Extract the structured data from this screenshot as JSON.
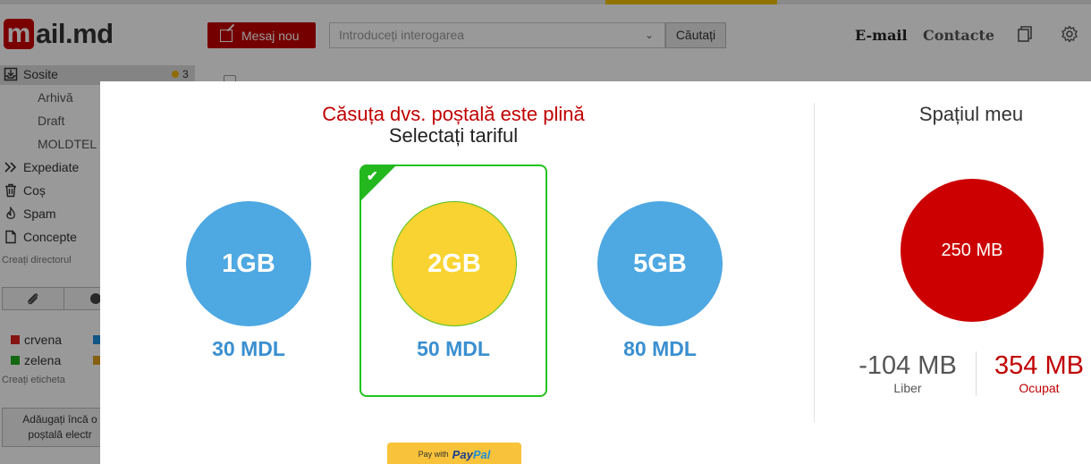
{
  "app": {
    "logo": {
      "letter": "m",
      "rest": "ail.md"
    },
    "compose_label": "Mesaj nou",
    "search": {
      "placeholder": "Introduceți interogarea",
      "button": "Căutați"
    },
    "nav": {
      "email": "E-mail",
      "contacts": "Contacte"
    },
    "sidebar": {
      "inbox": {
        "label": "Sosite",
        "count": "3"
      },
      "subfolders": [
        "Arhivă",
        "Draft",
        "MOLDTEL"
      ],
      "folders": [
        "Expediate",
        "Coș",
        "Spam",
        "Concepte"
      ],
      "create_folder": "Creați directorul",
      "labels": [
        {
          "name": "crvena",
          "color": "#e02020"
        },
        {
          "name": "zelena",
          "color": "#20b020"
        }
      ],
      "create_label": "Creați eticheta",
      "promo_line1": "Adăugați încă o",
      "promo_line2": "poștală electr"
    }
  },
  "modal": {
    "title": "Căsuța dvs. poștală este plină",
    "subtitle": "Selectați tariful",
    "plans": [
      {
        "size": "1GB",
        "price": "30 MDL",
        "color": "#4ea8e2",
        "selected": false
      },
      {
        "size": "2GB",
        "price": "50 MDL",
        "color": "#f9d331",
        "selected": true
      },
      {
        "size": "5GB",
        "price": "80 MDL",
        "color": "#4ea8e2",
        "selected": false
      }
    ],
    "paypal": {
      "prefix": "Pay with",
      "brand_a": "Pay",
      "brand_b": "Pal"
    },
    "my_space": {
      "title": "Spațiul meu",
      "total": "250 MB",
      "free_value": "-104 MB",
      "free_label": "Liber",
      "used_value": "354 MB",
      "used_label": "Ocupat"
    }
  }
}
